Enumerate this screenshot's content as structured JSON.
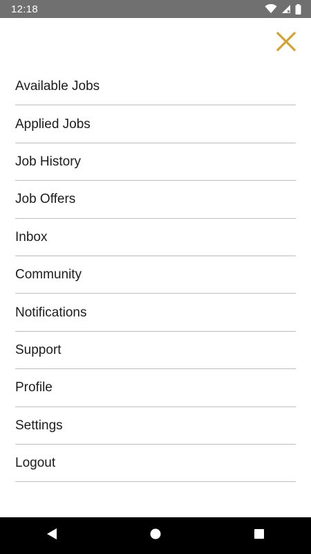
{
  "status_bar": {
    "time": "12:18",
    "icons": [
      "wifi-icon",
      "cellular-signal-icon",
      "battery-icon"
    ]
  },
  "close_button": {
    "icon": "close-icon",
    "color": "#D4A233"
  },
  "menu": {
    "items": [
      {
        "label": "Available Jobs"
      },
      {
        "label": "Applied Jobs"
      },
      {
        "label": "Job History"
      },
      {
        "label": "Job Offers"
      },
      {
        "label": "Inbox"
      },
      {
        "label": "Community"
      },
      {
        "label": "Notifications"
      },
      {
        "label": "Support"
      },
      {
        "label": "Profile"
      },
      {
        "label": "Settings"
      },
      {
        "label": "Logout"
      }
    ]
  },
  "nav_bar": {
    "buttons": [
      "back-icon",
      "home-icon",
      "recents-icon"
    ]
  }
}
